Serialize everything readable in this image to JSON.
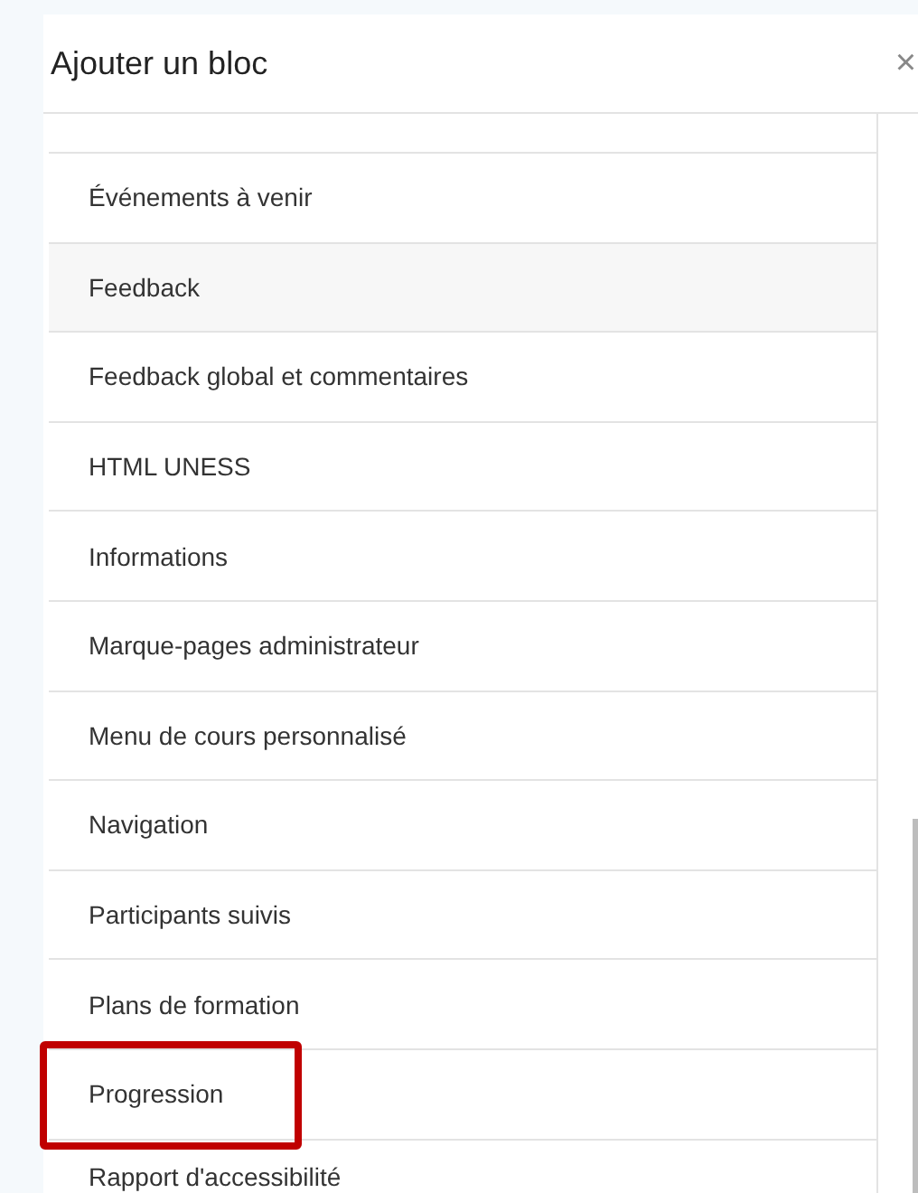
{
  "dialog": {
    "title": "Ajouter un bloc",
    "close": "×"
  },
  "items": [
    {
      "label": "Événements à venir",
      "hovered": false,
      "highlighted": false
    },
    {
      "label": "Feedback",
      "hovered": true,
      "highlighted": false
    },
    {
      "label": "Feedback global et commentaires",
      "hovered": false,
      "highlighted": false
    },
    {
      "label": "HTML UNESS",
      "hovered": false,
      "highlighted": false
    },
    {
      "label": "Informations",
      "hovered": false,
      "highlighted": false
    },
    {
      "label": "Marque-pages administrateur",
      "hovered": false,
      "highlighted": false
    },
    {
      "label": "Menu de cours personnalisé",
      "hovered": false,
      "highlighted": false
    },
    {
      "label": "Navigation",
      "hovered": false,
      "highlighted": false
    },
    {
      "label": "Participants suivis",
      "hovered": false,
      "highlighted": false
    },
    {
      "label": "Plans de formation",
      "hovered": false,
      "highlighted": false
    },
    {
      "label": "Progression",
      "hovered": false,
      "highlighted": true
    },
    {
      "label": "Rapport d'accessibilité",
      "hovered": false,
      "highlighted": false
    }
  ]
}
